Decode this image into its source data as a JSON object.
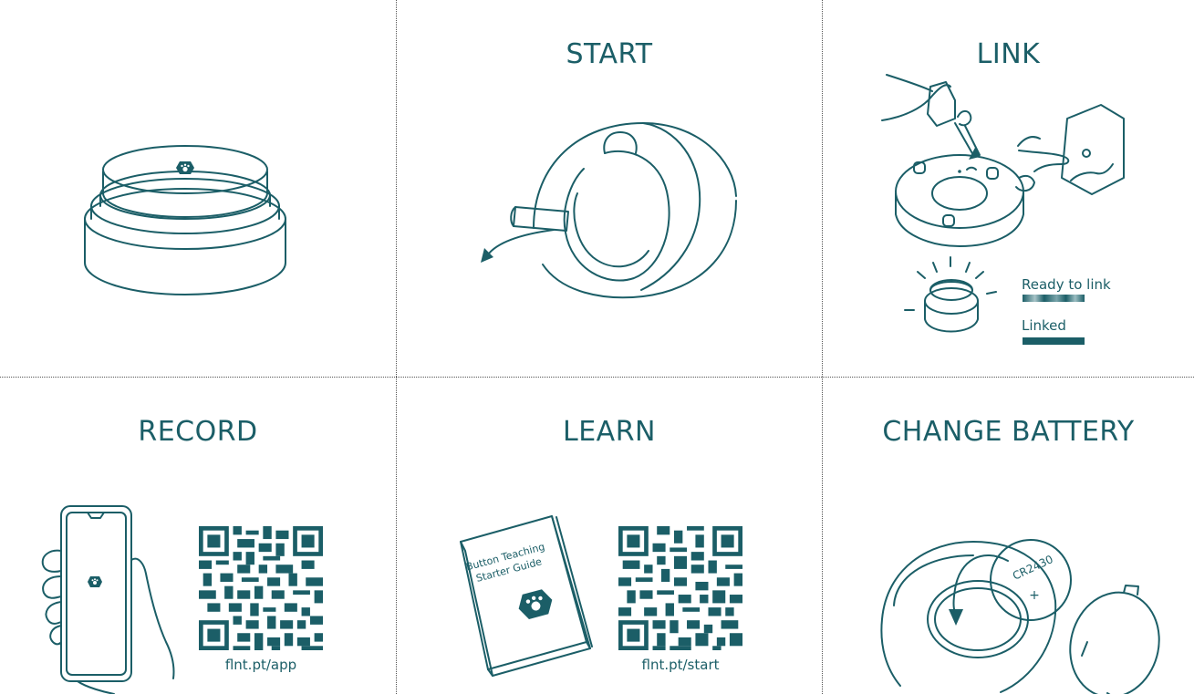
{
  "panels": {
    "start": {
      "title": "START"
    },
    "link": {
      "title": "LINK",
      "legend": [
        {
          "label": "Ready to link",
          "style": "gradient"
        },
        {
          "label": "Linked",
          "style": "solid"
        }
      ]
    },
    "record": {
      "title": "RECORD",
      "qr_caption": "flnt.pt/app"
    },
    "learn": {
      "title": "LEARN",
      "qr_caption": "flnt.pt/start",
      "book_title": "Button Teaching Starter Guide"
    },
    "change_battery": {
      "title": "CHANGE BATTERY",
      "battery_label": "CR2430",
      "battery_polarity": "+"
    }
  },
  "colors": {
    "accent": "#1b5e67",
    "divider": "#555555"
  }
}
